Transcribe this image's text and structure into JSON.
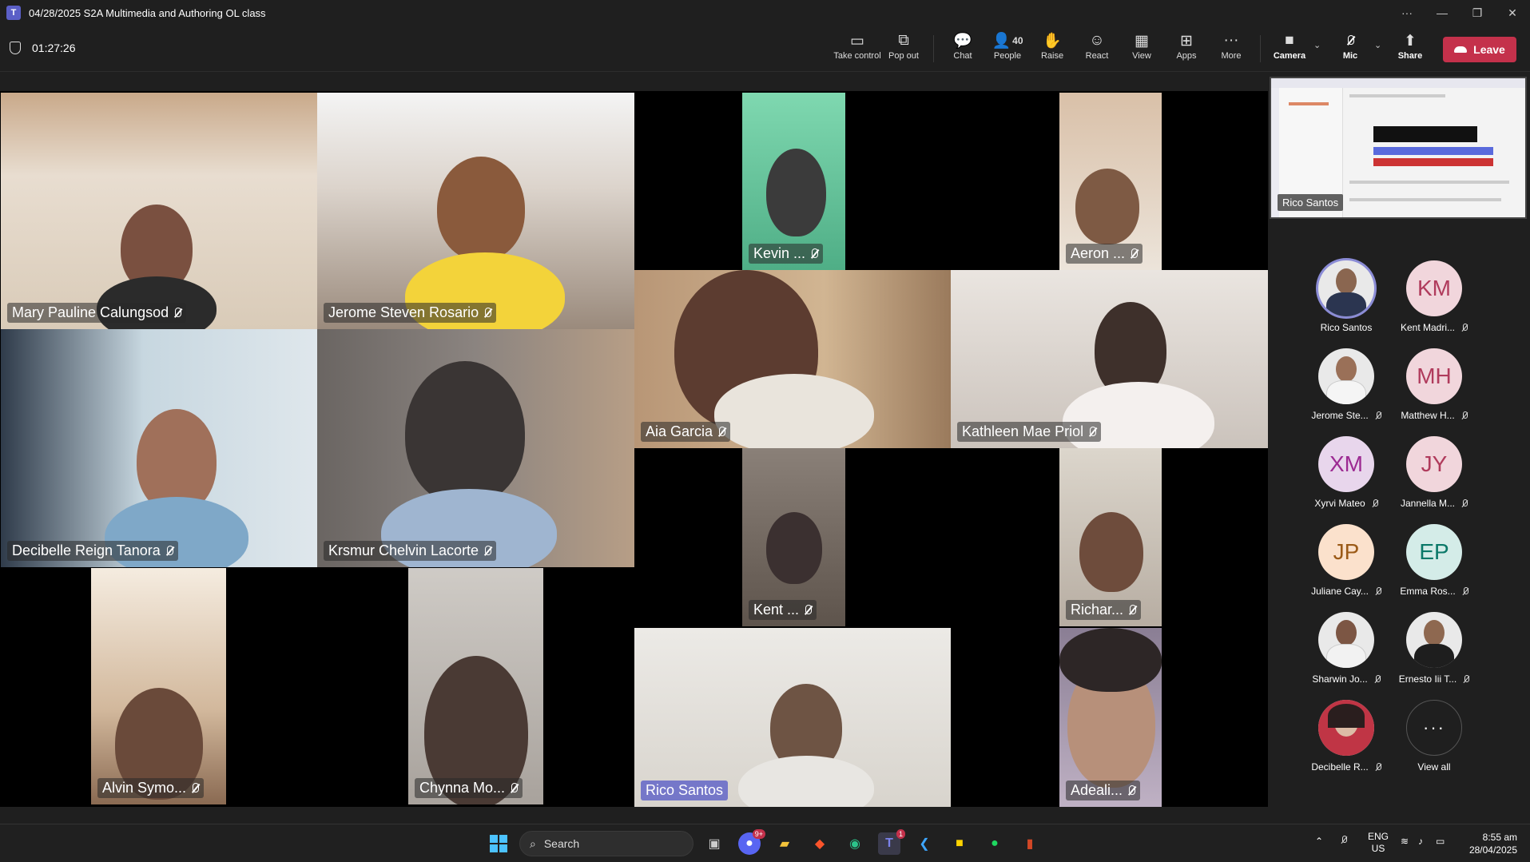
{
  "window": {
    "title": "04/28/2025 S2A Multimedia and Authoring OL class",
    "controls": [
      "more",
      "minimize",
      "restore",
      "close"
    ]
  },
  "toolbar": {
    "timer": "01:27:26",
    "take_control": "Take control",
    "pop_out": "Pop out",
    "chat": "Chat",
    "people": "People",
    "people_count": "40",
    "raise": "Raise",
    "react": "React",
    "view": "View",
    "apps": "Apps",
    "more": "More",
    "camera": "Camera",
    "mic": "Mic",
    "share": "Share",
    "leave": "Leave"
  },
  "tiles": [
    {
      "name": "Mary Pauline Calungsod",
      "muted": true
    },
    {
      "name": "Jerome Steven Rosario",
      "muted": true
    },
    {
      "name": "Kevin ...",
      "muted": true
    },
    {
      "name": "Aeron ...",
      "muted": true
    },
    {
      "name": "Decibelle Reign Tanora",
      "muted": true
    },
    {
      "name": "Krsmur Chelvin  Lacorte",
      "muted": true
    },
    {
      "name": "Aia Garcia",
      "muted": true
    },
    {
      "name": "Kathleen Mae  Priol",
      "muted": true
    },
    {
      "name": "Kent ...",
      "muted": true
    },
    {
      "name": "Richar...",
      "muted": true
    },
    {
      "name": "Alvin Symo...",
      "muted": true
    },
    {
      "name": "Chynna Mo...",
      "muted": true
    },
    {
      "name": "Rico Santos",
      "muted": false
    },
    {
      "name": "Adeali...",
      "muted": true
    }
  ],
  "screen_share": {
    "presenter": "Rico Santos"
  },
  "roster": [
    {
      "name": "Rico Santos",
      "initials": "",
      "muted": false
    },
    {
      "name": "Kent Madri...",
      "initials": "KM",
      "muted": true
    },
    {
      "name": "Jerome Ste...",
      "initials": "",
      "muted": true
    },
    {
      "name": "Matthew H...",
      "initials": "MH",
      "muted": true
    },
    {
      "name": "Xyrvi Mateo",
      "initials": "XM",
      "muted": true
    },
    {
      "name": "Jannella M...",
      "initials": "JY",
      "muted": true
    },
    {
      "name": "Juliane Cay...",
      "initials": "JP",
      "muted": true
    },
    {
      "name": "Emma Ros...",
      "initials": "EP",
      "muted": true
    },
    {
      "name": "Sharwin Jo...",
      "initials": "",
      "muted": true
    },
    {
      "name": "Ernesto Iii T...",
      "initials": "",
      "muted": true
    },
    {
      "name": "Decibelle R...",
      "initials": "",
      "muted": true
    },
    {
      "name": "View all",
      "initials": "···",
      "muted": false
    }
  ],
  "taskbar": {
    "search_placeholder": "Search",
    "discord_badge": "9+",
    "teams_badge": "1",
    "lang_top": "ENG",
    "lang_bottom": "US",
    "time": "8:55 am",
    "date": "28/04/2025"
  },
  "colors": {
    "accent": "#5b5fc7",
    "leave": "#c4314b",
    "background": "#1f1f1f"
  }
}
